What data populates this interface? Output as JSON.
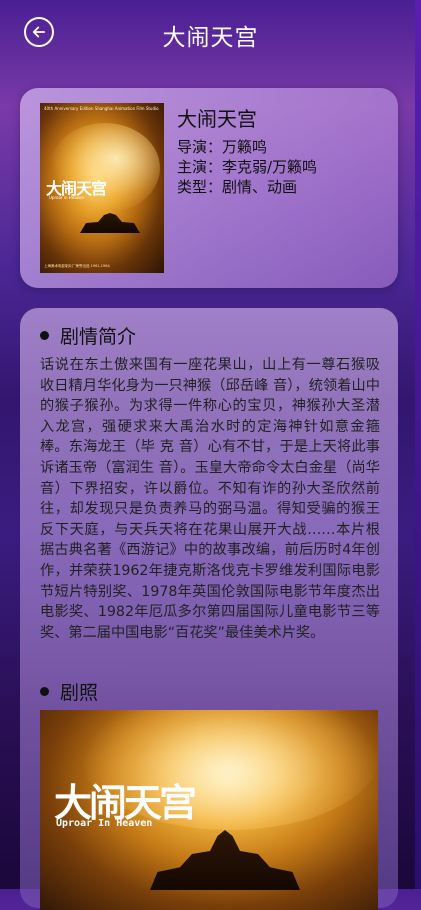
{
  "header": {
    "title": "大闹天宫",
    "back_icon": "back-arrow-icon"
  },
  "movie": {
    "name": "大闹天宫",
    "director": "导演：万籁鸣",
    "cast": "主演：李克弱/万籁鸣",
    "genre": "类型：剧情、动画",
    "poster": {
      "top_text": "40th Anniversary Edition Shanghai Animation Film Studio",
      "logo": "大闹天宫",
      "subtitle": "Uproar in Heaven",
      "bottom_text": "上海美术电影制片厂荣誉出品 1961-1964"
    }
  },
  "synopsis": {
    "heading": "剧情简介",
    "text": "话说在东土傲来国有一座花果山，山上有一尊石猴吸收日精月华化身为一只神猴（邱岳峰 音），统领着山中的猴子猴孙。为求得一件称心的宝贝，神猴孙大圣潜入龙宫，强硬求来大禹治水时的定海神针如意金箍棒。东海龙王（毕 克 音）心有不甘，于是上天将此事诉诸玉帝（富润生 音）。玉皇大帝命令太白金星（尚华 音）下界招安，许以爵位。不知有诈的孙大圣欣然前往，却发现只是负责养马的弼马温。得知受骗的猴王反下天庭，与天兵天将在花果山展开大战……本片根据古典名著《西游记》中的故事改编，前后历时4年创作，并荣获1962年捷克斯洛伐克卡罗维发利国际电影节短片特别奖、1978年英国伦敦国际电影节年度杰出电影奖、1982年厄瓜多尔第四届国际儿童电影节三等奖、第二届中国电影“百花奖”最佳美术片奖。"
  },
  "stills": {
    "heading": "剧照",
    "logo": "大闹天宫",
    "subtitle": "Uproar In Heaven"
  }
}
